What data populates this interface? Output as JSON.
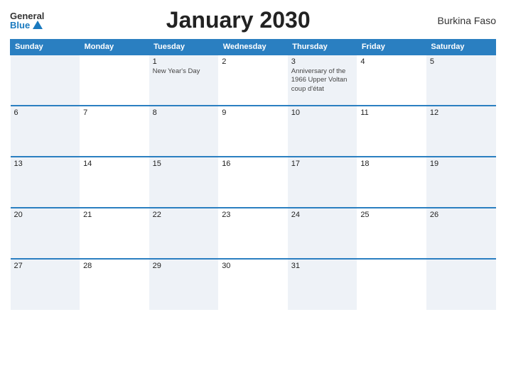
{
  "header": {
    "logo_general": "General",
    "logo_blue": "Blue",
    "title": "January 2030",
    "country": "Burkina Faso"
  },
  "weekdays": [
    "Sunday",
    "Monday",
    "Tuesday",
    "Wednesday",
    "Thursday",
    "Friday",
    "Saturday"
  ],
  "weeks": [
    [
      {
        "day": "",
        "events": []
      },
      {
        "day": "",
        "events": []
      },
      {
        "day": "1",
        "events": [
          "New Year's Day"
        ]
      },
      {
        "day": "2",
        "events": []
      },
      {
        "day": "3",
        "events": [
          "Anniversary of the 1966 Upper Voltan coup d'état"
        ]
      },
      {
        "day": "4",
        "events": []
      },
      {
        "day": "5",
        "events": []
      }
    ],
    [
      {
        "day": "6",
        "events": []
      },
      {
        "day": "7",
        "events": []
      },
      {
        "day": "8",
        "events": []
      },
      {
        "day": "9",
        "events": []
      },
      {
        "day": "10",
        "events": []
      },
      {
        "day": "11",
        "events": []
      },
      {
        "day": "12",
        "events": []
      }
    ],
    [
      {
        "day": "13",
        "events": []
      },
      {
        "day": "14",
        "events": []
      },
      {
        "day": "15",
        "events": []
      },
      {
        "day": "16",
        "events": []
      },
      {
        "day": "17",
        "events": []
      },
      {
        "day": "18",
        "events": []
      },
      {
        "day": "19",
        "events": []
      }
    ],
    [
      {
        "day": "20",
        "events": []
      },
      {
        "day": "21",
        "events": []
      },
      {
        "day": "22",
        "events": []
      },
      {
        "day": "23",
        "events": []
      },
      {
        "day": "24",
        "events": []
      },
      {
        "day": "25",
        "events": []
      },
      {
        "day": "26",
        "events": []
      }
    ],
    [
      {
        "day": "27",
        "events": []
      },
      {
        "day": "28",
        "events": []
      },
      {
        "day": "29",
        "events": []
      },
      {
        "day": "30",
        "events": []
      },
      {
        "day": "31",
        "events": []
      },
      {
        "day": "",
        "events": []
      },
      {
        "day": "",
        "events": []
      }
    ]
  ]
}
